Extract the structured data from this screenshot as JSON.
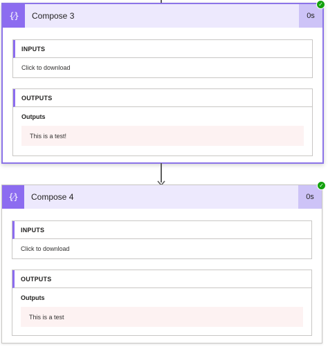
{
  "actions": [
    {
      "title": "Compose 3",
      "duration": "0s",
      "icon": "braces-icon",
      "status": "succeeded",
      "inputs": {
        "heading": "INPUTS",
        "link_text": "Click to download"
      },
      "outputs": {
        "heading": "OUTPUTS",
        "label": "Outputs",
        "value": "This is a test!"
      }
    },
    {
      "title": "Compose 4",
      "duration": "0s",
      "icon": "braces-icon",
      "status": "succeeded",
      "inputs": {
        "heading": "INPUTS",
        "link_text": "Click to download"
      },
      "outputs": {
        "heading": "OUTPUTS",
        "label": "Outputs",
        "value": "This is a test"
      }
    }
  ],
  "icons": {
    "braces_glyph": "{⁄}",
    "check_glyph": "✓"
  },
  "colors": {
    "accent": "#8c6cf0",
    "header_bg": "#ede9fd",
    "duration_bg": "#cdc3f7",
    "success": "#13a10e",
    "value_bg": "#fdf2f2"
  }
}
